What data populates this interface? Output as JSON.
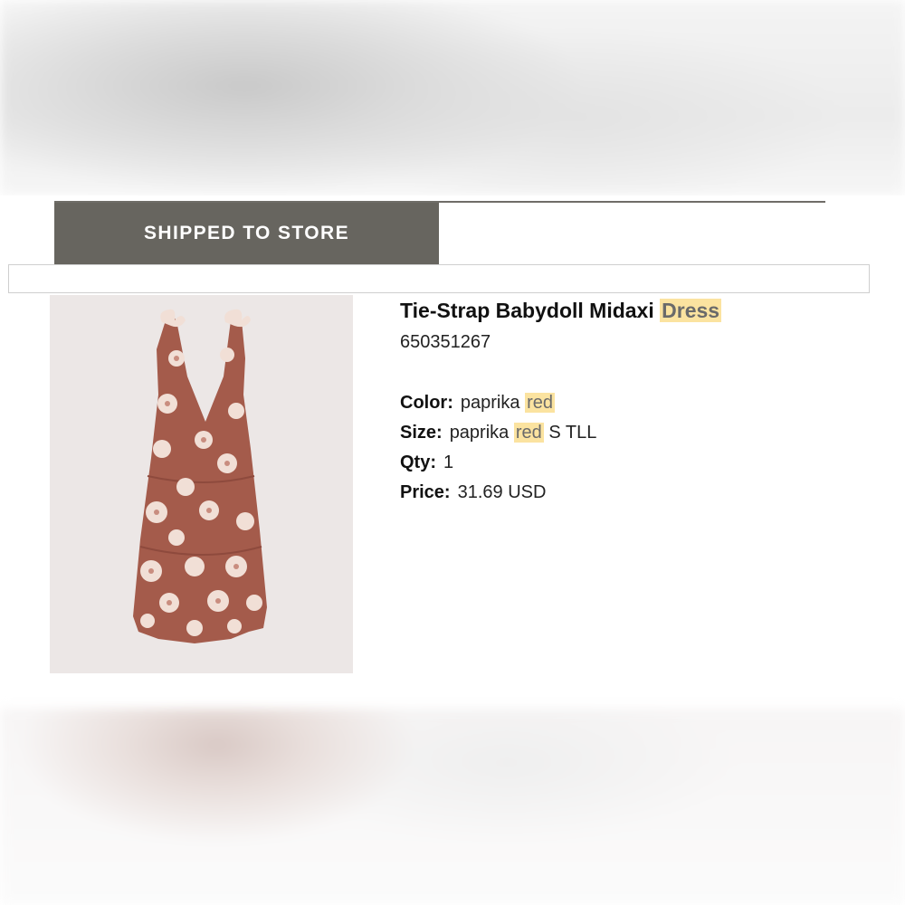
{
  "tabs": {
    "active_label": "SHIPPED TO STORE"
  },
  "product": {
    "title_main": "Tie-Strap Babydoll Midaxi",
    "title_highlight": "Dress",
    "sku": "650351267",
    "color_label": "Color:",
    "color_value_pre": "paprika",
    "color_value_highlight": "red",
    "size_label": "Size:",
    "size_value_pre": "paprika",
    "size_value_highlight": "red",
    "size_value_post": "S TLL",
    "qty_label": "Qty:",
    "qty_value": "1",
    "price_label": "Price:",
    "price_value": "31.69 USD"
  },
  "colors": {
    "tab_bg": "#67655f",
    "highlight": "#fbe3a0",
    "dress": "#a45b4b",
    "flower": "#f1dfd6"
  },
  "image": {
    "alt_semantic": "floral-dress-photo"
  }
}
